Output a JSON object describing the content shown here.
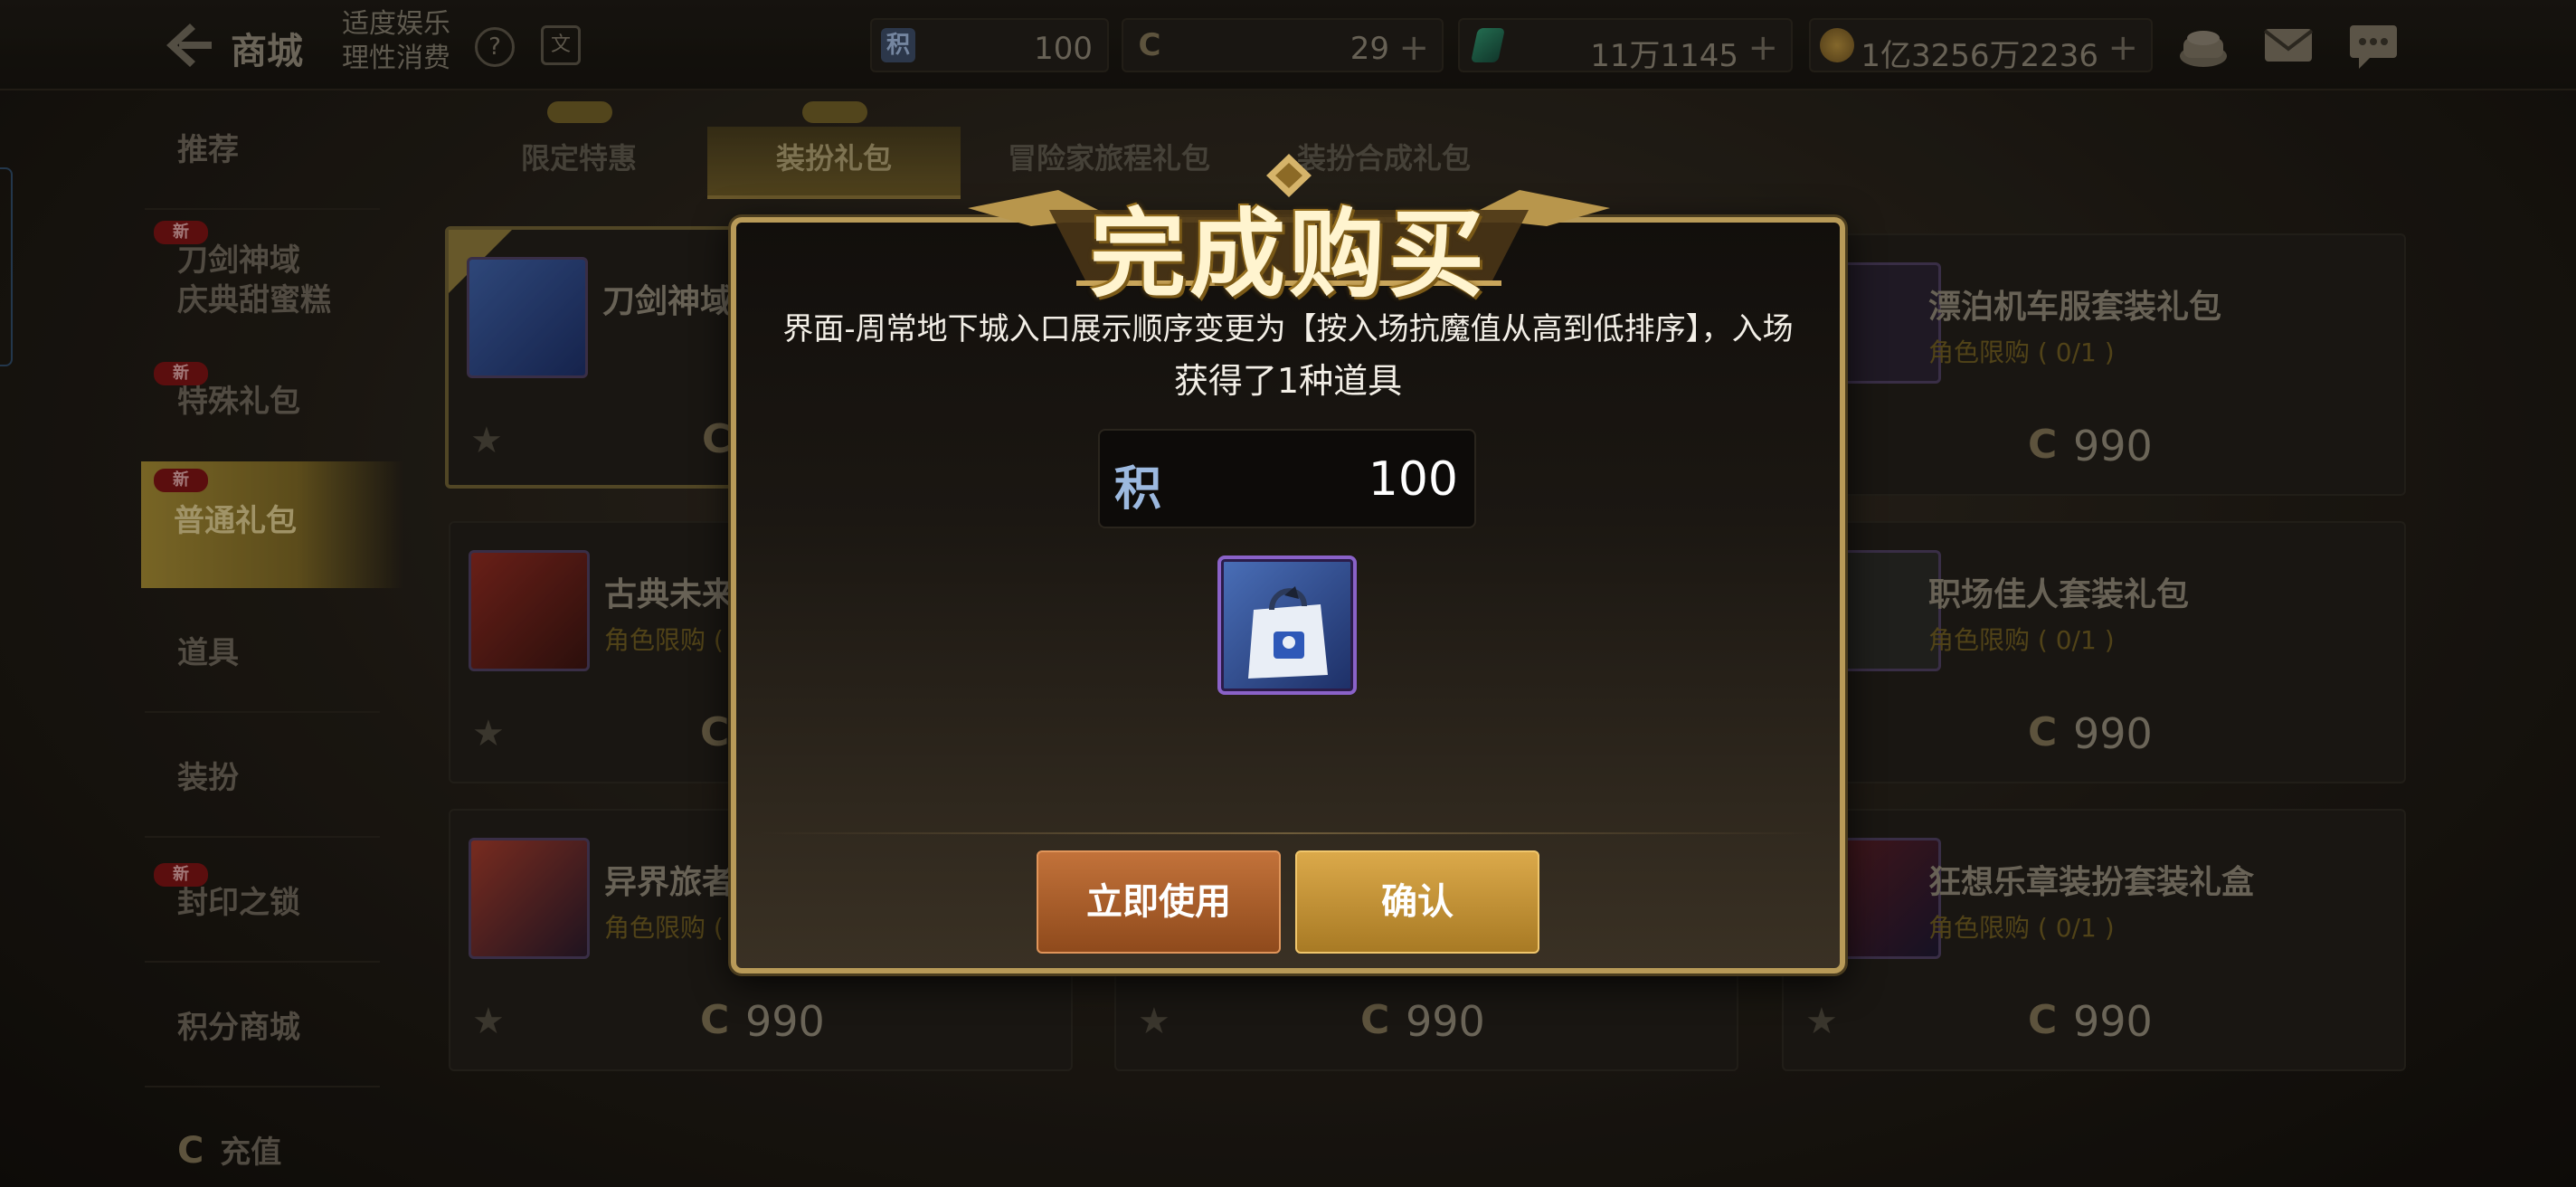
{
  "topbar": {
    "back_label": "商城",
    "notice_line1": "适度娱乐",
    "notice_line2": "理性消费",
    "help_glyph": "?",
    "info_glyph": "文",
    "currencies": [
      {
        "name": "积分",
        "icon": "points-icon",
        "glyph": "积",
        "value": "100",
        "has_plus": false
      },
      {
        "name": "代币券",
        "icon": "cera-coin-icon",
        "glyph": "C",
        "value": "29",
        "has_plus": true
      },
      {
        "name": "绿晶",
        "icon": "green-crystal-icon",
        "glyph": "",
        "value": "11万1145",
        "has_plus": true
      },
      {
        "name": "金币",
        "icon": "gold-coin-icon",
        "glyph": "",
        "value": "1亿3256万2236",
        "has_plus": true
      }
    ],
    "plus_glyph": "+"
  },
  "sidebar": {
    "items": [
      {
        "label": "推荐",
        "new": false
      },
      {
        "label": "刀剑神域\n庆典甜蜜糕",
        "new": true
      },
      {
        "label": "特殊礼包",
        "new": true
      },
      {
        "label": "普通礼包",
        "new": true,
        "active": true
      },
      {
        "label": "道具",
        "new": false
      },
      {
        "label": "装扮",
        "new": false
      },
      {
        "label": "封印之锁",
        "new": true
      },
      {
        "label": "积分商城",
        "new": false
      },
      {
        "label": "充值",
        "new": false
      }
    ],
    "new_badge": "新"
  },
  "tabs": [
    {
      "label": "限定特惠",
      "badge": true
    },
    {
      "label": "装扮礼包",
      "badge": true,
      "active": true
    },
    {
      "label": "冒险家旅程礼包",
      "badge": false
    },
    {
      "label": "装扮合成礼包",
      "badge": false
    }
  ],
  "cards": [
    {
      "name": "刀剑神域",
      "limit": "",
      "price": "",
      "highlight": true
    },
    {
      "name": "漂泊机车服套装礼包",
      "limit": "角色限购 ( 0/1 )",
      "price": "990"
    },
    {
      "name": "古典未来",
      "limit": "角色限购 (",
      "price": ""
    },
    {
      "name": "职场佳人套装礼包",
      "limit": "角色限购 ( 0/1 )",
      "price": "990"
    },
    {
      "name": "异界旅者",
      "limit": "角色限购 (",
      "price": "990"
    },
    {
      "name": "",
      "limit": "",
      "price": "990"
    },
    {
      "name": "狂想乐章装扮套装礼盒",
      "limit": "角色限购 ( 0/1 )",
      "price": "990"
    }
  ],
  "coin_glyph": "C",
  "star_glyph": "★",
  "modal": {
    "title": "完成购买",
    "message_line1": "界面-周常地下城入口展示顺序变更为【按入场抗魔值从高到低排序】，入场",
    "message_line2": "获得了1种道具",
    "points_glyph": "积",
    "points_value": "100",
    "item_icon": "shopping-bag-icon",
    "use_button": "立即使用",
    "confirm_button": "确认"
  },
  "colors": {
    "accent_gold": "#b89a58",
    "use_button": "#b5622b",
    "confirm_button": "#c8922e",
    "limit_text": "#6d5a20"
  }
}
